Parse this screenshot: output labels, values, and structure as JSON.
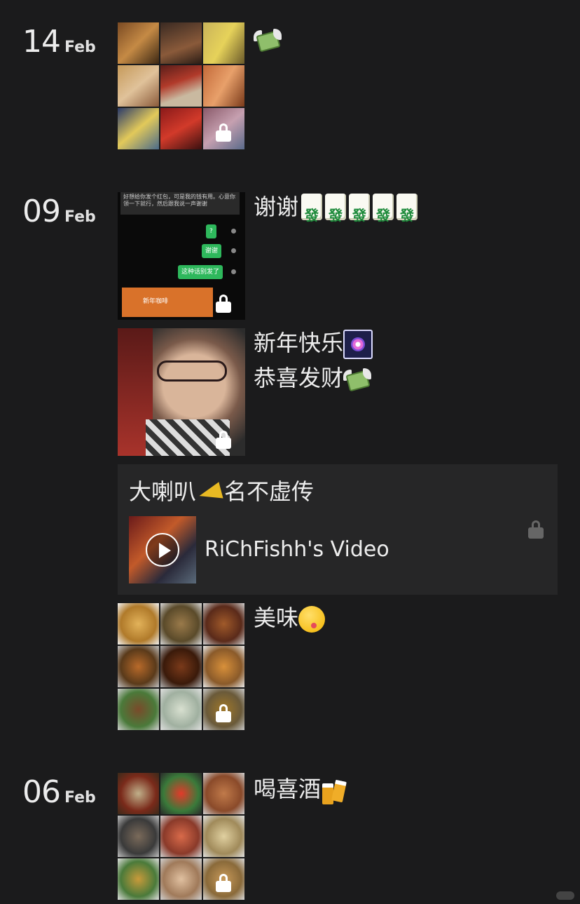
{
  "posts": [
    {
      "day": "14",
      "month": "Feb",
      "caption": ""
    },
    {
      "day": "09",
      "month": "Feb",
      "caption": "谢谢"
    },
    {
      "caption_line1": "新年快乐",
      "caption_line2": "恭喜发财"
    },
    {
      "card_title_text": "大喇叭",
      "card_title_text2": "名不虚传",
      "video_label": "RiChFishh's Video"
    },
    {
      "caption": "美味"
    },
    {
      "day": "06",
      "month": "Feb",
      "caption": "喝喜酒"
    }
  ],
  "chat": {
    "grey_text": "好想给你发个红包，可是我的钱有用。心意你领一下就行，然后跟我说一声谢谢",
    "bubble1": "?",
    "bubble2": "谢谢",
    "bubble3": "这种话别发了",
    "red_packet": "新年咖啡"
  },
  "colors": {
    "background": "#1b1b1c",
    "card": "#262627",
    "chat_green": "#2eb85c"
  },
  "icons": [
    "money-with-wings-icon",
    "mahjong-tile-icon",
    "fireworks-icon",
    "megaphone-icon",
    "yum-face-icon",
    "beer-mugs-icon",
    "lock-icon",
    "play-icon"
  ]
}
